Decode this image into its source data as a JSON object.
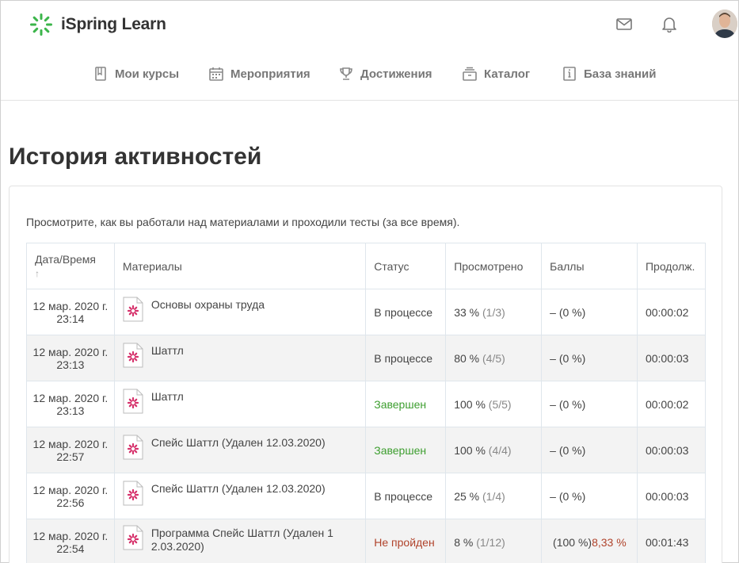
{
  "app": {
    "name": "iSpring Learn"
  },
  "nav": [
    {
      "label": "Мои курсы",
      "icon": "book-icon"
    },
    {
      "label": "Мероприятия",
      "icon": "calendar-icon"
    },
    {
      "label": "Достижения",
      "icon": "trophy-icon"
    },
    {
      "label": "Каталог",
      "icon": "catalog-icon"
    },
    {
      "label": "База знаний",
      "icon": "knowledge-base-icon"
    }
  ],
  "page": {
    "title": "История активностей",
    "intro": "Просмотрите, как вы работали над материалами и проходили тесты (за все время)."
  },
  "table": {
    "headers": {
      "date": "Дата/Время",
      "materials": "Материалы",
      "status": "Статус",
      "viewed": "Просмотрено",
      "score": "Баллы",
      "duration": "Продолж."
    },
    "sort_indicator": "↑",
    "rows": [
      {
        "date": "12 мар. 2020 г.",
        "time": "23:14",
        "material": "Основы охраны труда",
        "status": "В процессе",
        "viewed_pct": "33 %",
        "viewed_cnt": "(1/3)",
        "score_a": "– (0 %)",
        "score_b": "",
        "duration": "00:00:02"
      },
      {
        "date": "12 мар. 2020 г.",
        "time": "23:13",
        "material": "Шаттл",
        "status": "В процессе",
        "viewed_pct": "80 %",
        "viewed_cnt": "(4/5)",
        "score_a": "– (0 %)",
        "score_b": "",
        "duration": "00:00:03"
      },
      {
        "date": "12 мар. 2020 г.",
        "time": "23:13",
        "material": "Шаттл",
        "status": "Завершен",
        "viewed_pct": "100 %",
        "viewed_cnt": "(5/5)",
        "score_a": "– (0 %)",
        "score_b": "",
        "duration": "00:00:02"
      },
      {
        "date": "12 мар. 2020 г.",
        "time": "22:57",
        "material": "Спейс Шаттл (Удален 12.03.2020)",
        "status": "Завершен",
        "viewed_pct": "100 %",
        "viewed_cnt": "(4/4)",
        "score_a": "– (0 %)",
        "score_b": "",
        "duration": "00:00:03"
      },
      {
        "date": "12 мар. 2020 г.",
        "time": "22:56",
        "material": "Спейс Шаттл (Удален 12.03.2020)",
        "status": "В процессе",
        "viewed_pct": "25 %",
        "viewed_cnt": "(1/4)",
        "score_a": "– (0 %)",
        "score_b": "",
        "duration": "00:00:03"
      },
      {
        "date": "12 мар. 2020 г.",
        "time": "22:54",
        "material": "Программа Спейс Шаттл (Удален 1 2.03.2020)",
        "status": "Не пройден",
        "viewed_pct": "8 %",
        "viewed_cnt": "(1/12)",
        "score_a": "(100 %)",
        "score_b": "8,33 %",
        "duration": "00:01:43"
      }
    ]
  },
  "colors": {
    "brand": "#3bb54a",
    "green": "#3d9e2f",
    "red": "#b0432b",
    "icon_pink": "#d6336c"
  }
}
